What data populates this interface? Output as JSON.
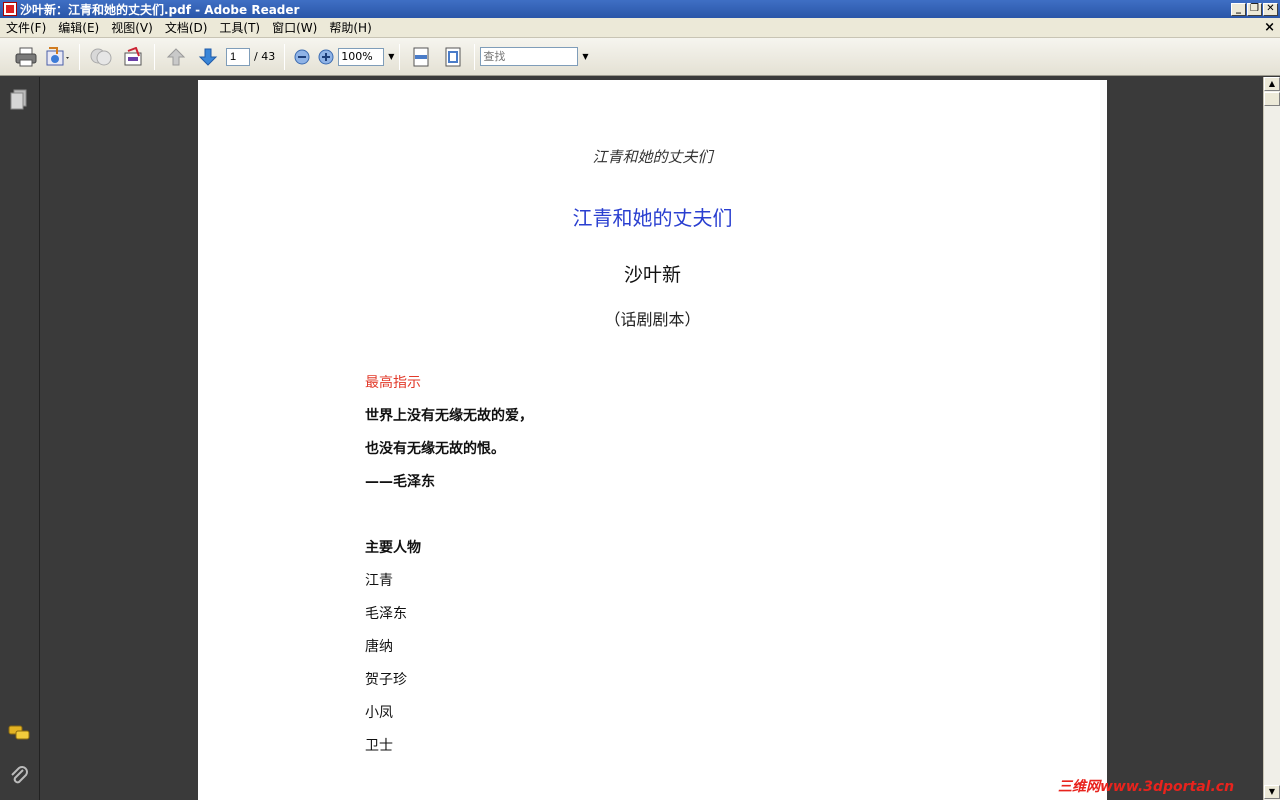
{
  "window": {
    "title": "沙叶新：江青和她的丈夫们.pdf - Adobe Reader",
    "minimize": "_",
    "restore": "❐",
    "close": "✕"
  },
  "menubar": {
    "items": [
      {
        "label": "文件(F)"
      },
      {
        "label": "编辑(E)"
      },
      {
        "label": "视图(V)"
      },
      {
        "label": "文档(D)"
      },
      {
        "label": "工具(T)"
      },
      {
        "label": "窗口(W)"
      },
      {
        "label": "帮助(H)"
      }
    ],
    "doc_close": "×"
  },
  "toolbar": {
    "page_current": "1",
    "page_total": "/ 43",
    "zoom": "100%",
    "search_placeholder": "查找"
  },
  "document": {
    "header": "江青和她的丈夫们",
    "title": "江青和她的丈夫们",
    "author": "沙叶新",
    "subtitle": "（话剧剧本）",
    "directive_label": "最高指示",
    "quote_line1": "世界上没有无缘无故的爱，",
    "quote_line2": "也没有无缘无故的恨。",
    "quote_attrib": "——毛泽东",
    "characters_heading": "主要人物",
    "characters": [
      "江青",
      "毛泽东",
      "唐纳",
      "贺子珍",
      "小凤",
      "卫士"
    ]
  },
  "watermark": "三维网www.3dportal.cn",
  "colors": {
    "title_blue": "#2a3fd0",
    "directive_red": "#e23a2a",
    "background": "#3a3a3a"
  }
}
